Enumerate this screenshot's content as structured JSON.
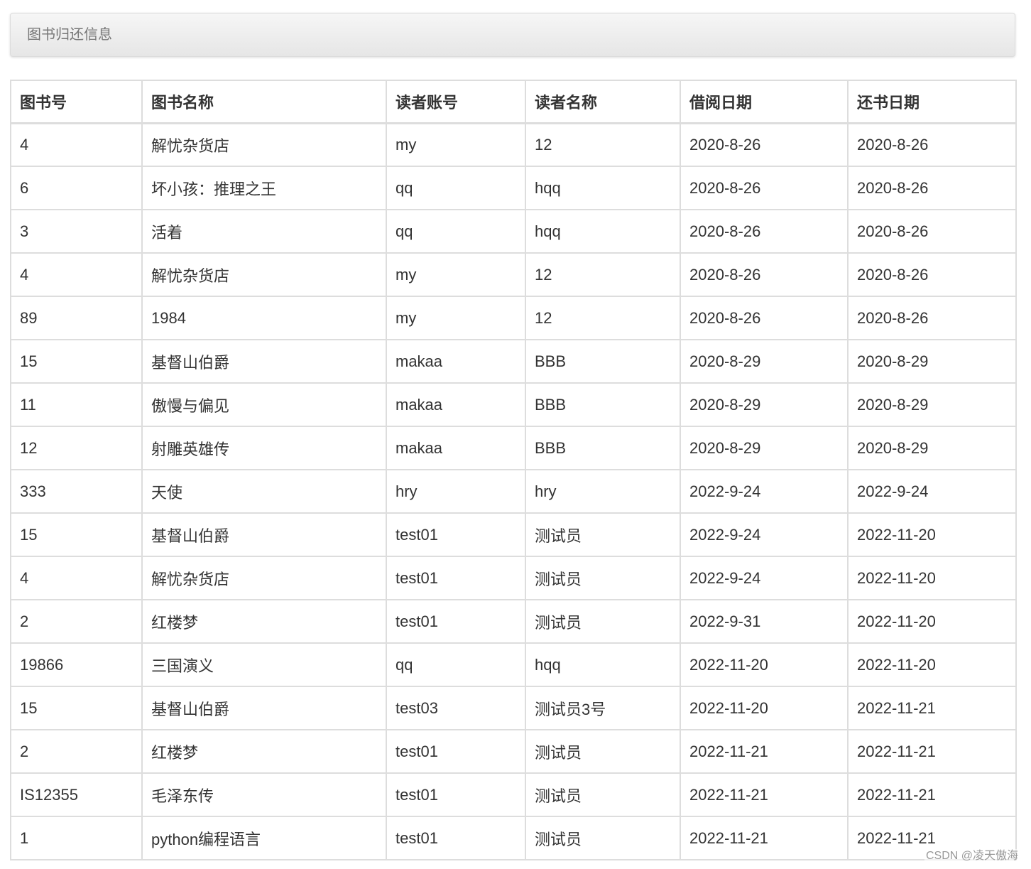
{
  "panel": {
    "title": "图书归还信息"
  },
  "table": {
    "columns": [
      "图书号",
      "图书名称",
      "读者账号",
      "读者名称",
      "借阅日期",
      "还书日期"
    ],
    "rows": [
      [
        "4",
        "解忧杂货店",
        "my",
        "12",
        "2020-8-26",
        "2020-8-26"
      ],
      [
        "6",
        "坏小孩：推理之王",
        "qq",
        "hqq",
        "2020-8-26",
        "2020-8-26"
      ],
      [
        "3",
        "活着",
        "qq",
        "hqq",
        "2020-8-26",
        "2020-8-26"
      ],
      [
        "4",
        "解忧杂货店",
        "my",
        "12",
        "2020-8-26",
        "2020-8-26"
      ],
      [
        "89",
        "1984",
        "my",
        "12",
        "2020-8-26",
        "2020-8-26"
      ],
      [
        "15",
        "基督山伯爵",
        "makaa",
        "BBB",
        "2020-8-29",
        "2020-8-29"
      ],
      [
        "11",
        "傲慢与偏见",
        "makaa",
        "BBB",
        "2020-8-29",
        "2020-8-29"
      ],
      [
        "12",
        "射雕英雄传",
        "makaa",
        "BBB",
        "2020-8-29",
        "2020-8-29"
      ],
      [
        "333",
        "天使",
        "hry",
        "hry",
        "2022-9-24",
        "2022-9-24"
      ],
      [
        "15",
        "基督山伯爵",
        "test01",
        "测试员",
        "2022-9-24",
        "2022-11-20"
      ],
      [
        "4",
        "解忧杂货店",
        "test01",
        "测试员",
        "2022-9-24",
        "2022-11-20"
      ],
      [
        "2",
        "红楼梦",
        "test01",
        "测试员",
        "2022-9-31",
        "2022-11-20"
      ],
      [
        "19866",
        "三国演义",
        "qq",
        "hqq",
        "2022-11-20",
        "2022-11-20"
      ],
      [
        "15",
        "基督山伯爵",
        "test03",
        "测试员3号",
        "2022-11-20",
        "2022-11-21"
      ],
      [
        "2",
        "红楼梦",
        "test01",
        "测试员",
        "2022-11-21",
        "2022-11-21"
      ],
      [
        "IS12355",
        "毛泽东传",
        "test01",
        "测试员",
        "2022-11-21",
        "2022-11-21"
      ],
      [
        "1",
        "python编程语言",
        "test01",
        "测试员",
        "2022-11-21",
        "2022-11-21"
      ]
    ]
  },
  "watermark": "CSDN @凌天傲海",
  "colors": {
    "border": "#dddddd",
    "text": "#333333",
    "panel_title": "#777777",
    "panel_bg_top": "#f6f6f6",
    "panel_bg_bottom": "#e6e6e6"
  }
}
